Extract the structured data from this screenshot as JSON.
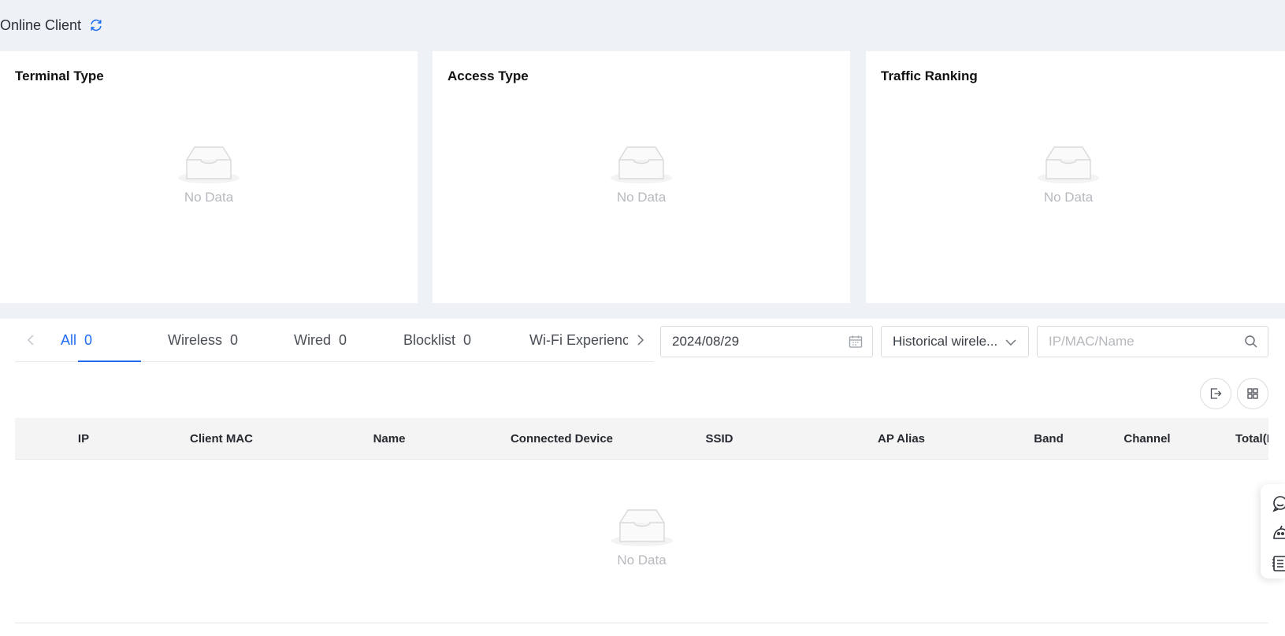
{
  "header": {
    "title": "Online Client",
    "refresh_icon": "refresh-icon"
  },
  "cards": [
    {
      "title": "Terminal Type",
      "empty_text": "No Data"
    },
    {
      "title": "Access Type",
      "empty_text": "No Data"
    },
    {
      "title": "Traffic Ranking",
      "empty_text": "No Data"
    }
  ],
  "tabs": [
    {
      "label": "All",
      "count": "0",
      "active": true
    },
    {
      "label": "Wireless",
      "count": "0"
    },
    {
      "label": "Wired",
      "count": "0"
    },
    {
      "label": "Blocklist",
      "count": "0"
    },
    {
      "label": "Wi-Fi Experience",
      "count": ""
    }
  ],
  "filters": {
    "date": "2024/08/29",
    "history_select": "Historical wirele...",
    "search_placeholder": "IP/MAC/Name"
  },
  "table": {
    "columns": [
      "IP",
      "Client MAC",
      "Name",
      "Connected Device",
      "SSID",
      "AP Alias",
      "Band",
      "Channel",
      "Total(M"
    ],
    "empty_text": "No Data"
  },
  "colors": {
    "accent": "#1f6cf2",
    "background": "#eef2f6",
    "header_bg": "#f4f4f5",
    "empty_text": "#b6b9be"
  }
}
